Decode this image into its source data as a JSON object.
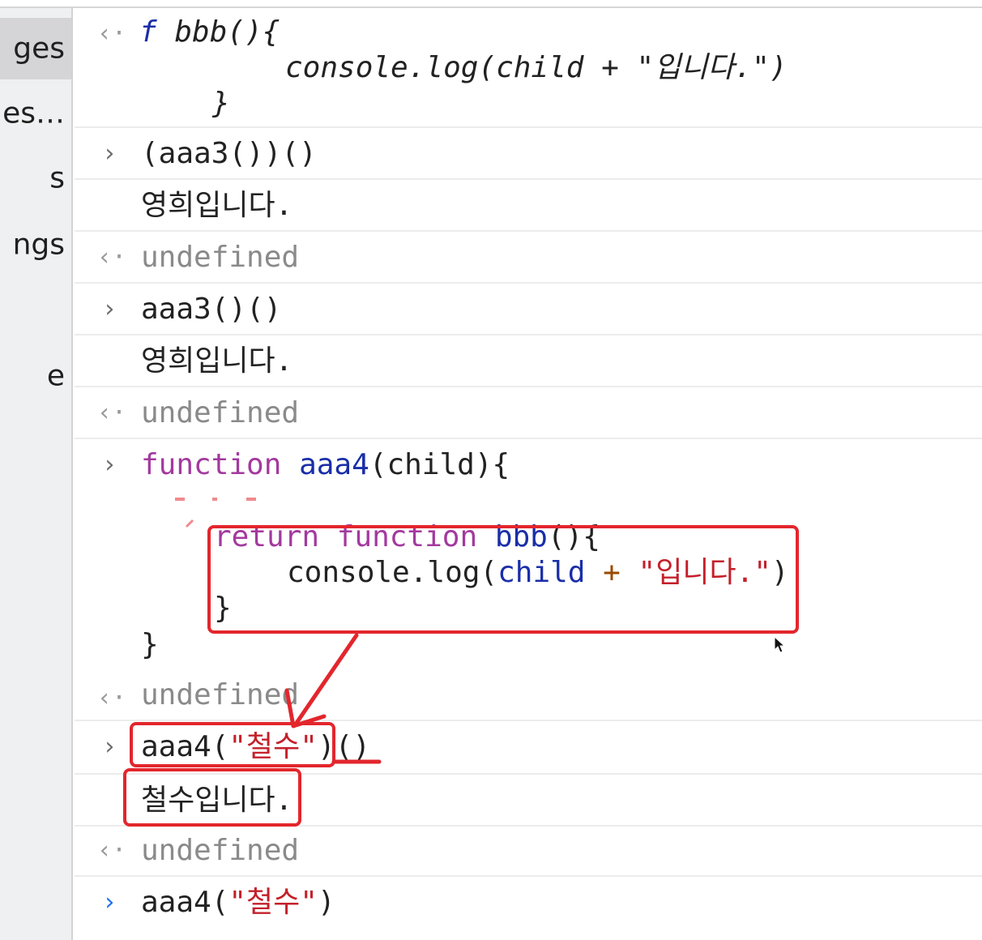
{
  "sidebar": {
    "items": [
      {
        "label": "ges"
      },
      {
        "label": "es…"
      },
      {
        "label": "s"
      },
      {
        "label": "ngs"
      },
      {
        "label": "e"
      }
    ]
  },
  "console": {
    "output1": {
      "line1_f": "f",
      "line1_rest": "bbb(){",
      "line2": "console.log(child + \"입니다.\")",
      "line3": "}"
    },
    "input1": "(aaa3())()",
    "log1": "영희입니다.",
    "result1": "undefined",
    "input2": "aaa3()()",
    "log2": "영희입니다.",
    "result2": "undefined",
    "input3": {
      "kw_function": "function",
      "name": "aaa4",
      "params": "(child){",
      "ret_kw": "return",
      "ret_function": "function",
      "ret_name": "bbb",
      "ret_paren": "(){",
      "body_console": "console.log(",
      "body_child": "child",
      "body_plus": "+",
      "body_str": "\"입니다.\"",
      "body_close": ")",
      "inner_close": "}",
      "outer_close": "}"
    },
    "result3": "undefined",
    "input4": {
      "call": "aaa4(",
      "arg": "\"철수\"",
      "close": ")",
      "invoke": "()"
    },
    "log3": "철수입니다.",
    "result4": "undefined",
    "input5": {
      "call": "aaa4(",
      "arg": "\"철수\"",
      "close": ")"
    }
  },
  "prompts": {
    "input": "›",
    "output": "‹·"
  },
  "colors": {
    "annotation": "#e3262d",
    "keyword": "#a3399f",
    "function_name": "#1a2ea8",
    "string": "#c4202b",
    "prompt_active": "#1a6ff0"
  }
}
